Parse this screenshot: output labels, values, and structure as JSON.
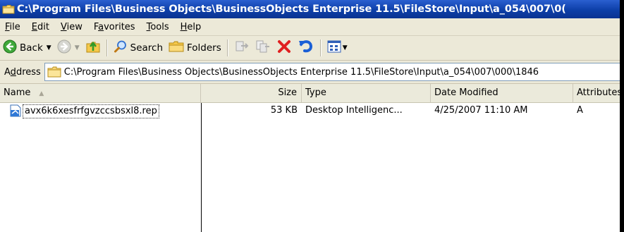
{
  "window": {
    "title": "C:\\Program Files\\Business Objects\\BusinessObjects Enterprise 11.5\\FileStore\\Input\\a_054\\007\\0("
  },
  "menu": {
    "items": [
      {
        "first": "F",
        "rest": "ile"
      },
      {
        "first": "E",
        "rest": "dit"
      },
      {
        "first": "V",
        "rest": "iew"
      },
      {
        "pre": "F",
        "first": "a",
        "rest": "vorites"
      },
      {
        "first": "T",
        "rest": "ools"
      },
      {
        "first": "H",
        "rest": "elp"
      }
    ]
  },
  "toolbar": {
    "back_label": "Back",
    "search_label": "Search",
    "folders_label": "Folders"
  },
  "address": {
    "label_first": "A",
    "label_u": "d",
    "label_rest": "dress",
    "path": "C:\\Program Files\\Business Objects\\BusinessObjects Enterprise 11.5\\FileStore\\Input\\a_054\\007\\000\\1846"
  },
  "list": {
    "columns": {
      "name": "Name",
      "size": "Size",
      "type": "Type",
      "date": "Date Modified",
      "attributes": "Attributes"
    },
    "rows": [
      {
        "name": "avx6k6xesfrfgvzccsbsxl8.rep",
        "size": "53 KB",
        "type": "Desktop Intelligenc...",
        "date": "4/25/2007 11:10 AM",
        "attributes": "A"
      }
    ]
  },
  "icons": {
    "title": "folder-icon",
    "back": "back-arrow-icon",
    "forward": "forward-arrow-icon",
    "up": "up-folder-icon",
    "search": "search-icon",
    "folders": "folders-icon",
    "move": "move-to-icon",
    "copy": "copy-to-icon",
    "delete": "delete-icon",
    "undo": "undo-icon",
    "views": "views-icon",
    "file": "rep-file-icon"
  },
  "colors": {
    "titlebar": "#0d3fa8",
    "chrome": "#ece9d8",
    "delete": "#e02020",
    "undo": "#1a5fd6"
  }
}
